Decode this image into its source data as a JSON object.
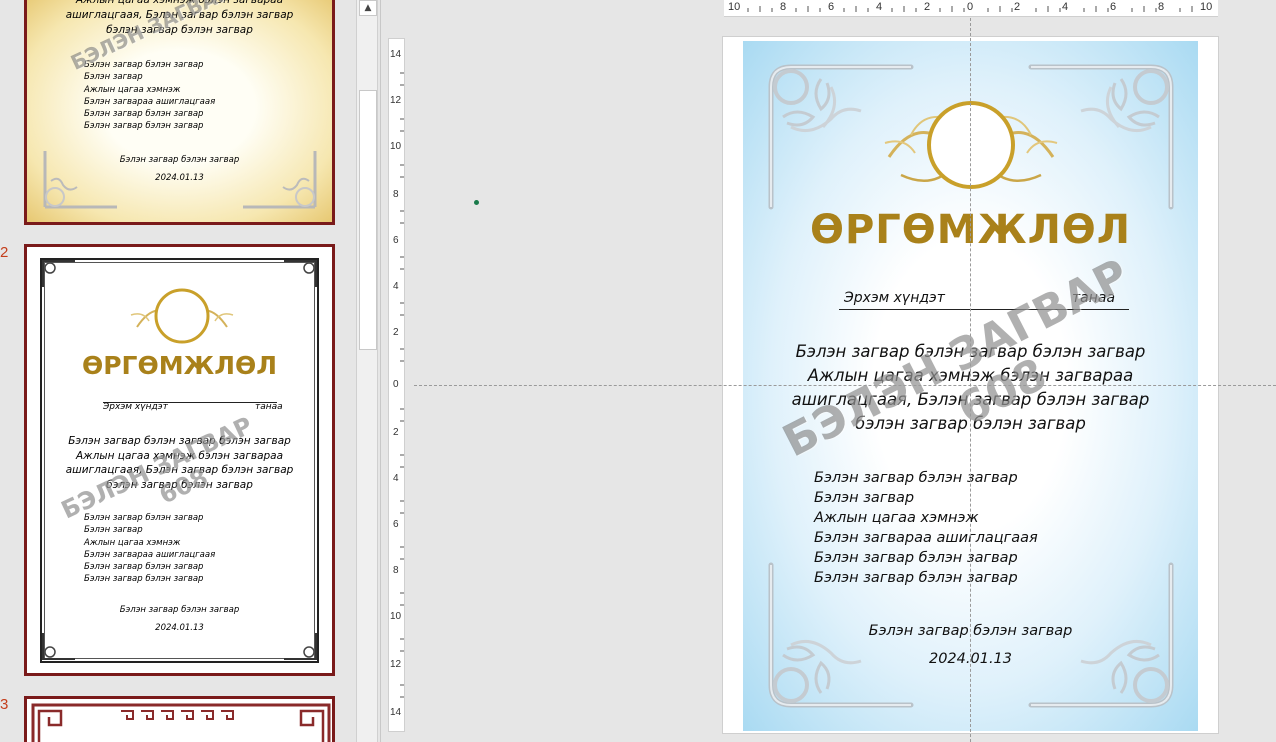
{
  "thumbnails": {
    "slide_numbers": [
      "2",
      "3"
    ],
    "slide1": {
      "body_lines": [
        "Ажлын цагаа хэмнэж бэлэн загвараа",
        "ашиглацгаая, Бэлэн загвар бэлэн загвар",
        "бэлэн загвар бэлэн загвар"
      ],
      "list": [
        "Бэлэн загвар бэлэн загвар",
        "Бэлэн загвар",
        "Ажлын цагаа хэмнэж",
        "Бэлэн загвараа ашиглацгаая",
        "Бэлэн загвар бэлэн загвар",
        "Бэлэн загвар бэлэн загвар"
      ],
      "footer": "Бэлэн загвар бэлэн загвар",
      "date": "2024.01.13"
    },
    "slide2": {
      "title": "ӨРГӨМЖЛӨЛ",
      "recipient_left": "Эрхэм хүндэт",
      "recipient_right": "танаа",
      "body_lines": [
        "Бэлэн загвар бэлэн загвар бэлэн загвар",
        "Ажлын цагаа хэмнэж бэлэн загвараа",
        "ашиглацгаая, Бэлэн загвар бэлэн загвар",
        "бэлэн загвар бэлэн загвар"
      ],
      "list": [
        "Бэлэн загвар бэлэн загвар",
        "Бэлэн загвар",
        "Ажлын цагаа хэмнэж",
        "Бэлэн загвараа ашиглацгаая",
        "Бэлэн загвар бэлэн загвар",
        "Бэлэн загвар бэлэн загвар"
      ],
      "footer": "Бэлэн загвар бэлэн загвар",
      "date": "2024.01.13",
      "watermark_line1": "БЭЛЭН ЗАГВАР",
      "watermark_line2": "608"
    }
  },
  "rulers": {
    "horizontal": [
      "10",
      "8",
      "6",
      "4",
      "2",
      "0",
      "2",
      "4",
      "6",
      "8",
      "10"
    ],
    "vertical": [
      "14",
      "12",
      "10",
      "8",
      "6",
      "4",
      "2",
      "0",
      "2",
      "4",
      "6",
      "8",
      "10",
      "12",
      "14"
    ]
  },
  "slide": {
    "title": "ӨРГӨМЖЛӨЛ",
    "recipient_left": "Эрхэм хүндэт",
    "recipient_right": "танаа",
    "body_lines": [
      "Бэлэн загвар бэлэн загвар бэлэн загвар",
      "Ажлын цагаа хэмнэж бэлэн загвараа",
      "ашиглацгаая, Бэлэн загвар бэлэн загвар",
      "бэлэн загвар бэлэн загвар"
    ],
    "list": [
      "Бэлэн загвар бэлэн загвар",
      "Бэлэн загвар",
      "Ажлын цагаа хэмнэж",
      "Бэлэн загвараа ашиглацгаая",
      "Бэлэн загвар бэлэн загвар",
      "Бэлэн загвар бэлэн загвар"
    ],
    "footer": "Бэлэн загвар бэлэн загвар",
    "date": "2024.01.13",
    "watermark_line1": "БЭЛЭН ЗАГВАР",
    "watermark_line2": "608"
  },
  "colors": {
    "title_gold": "#a9811a",
    "thumb_border": "#7a1a1a",
    "slide_number": "#c43e1c",
    "slide_bg_blue": "#a9daf2"
  }
}
